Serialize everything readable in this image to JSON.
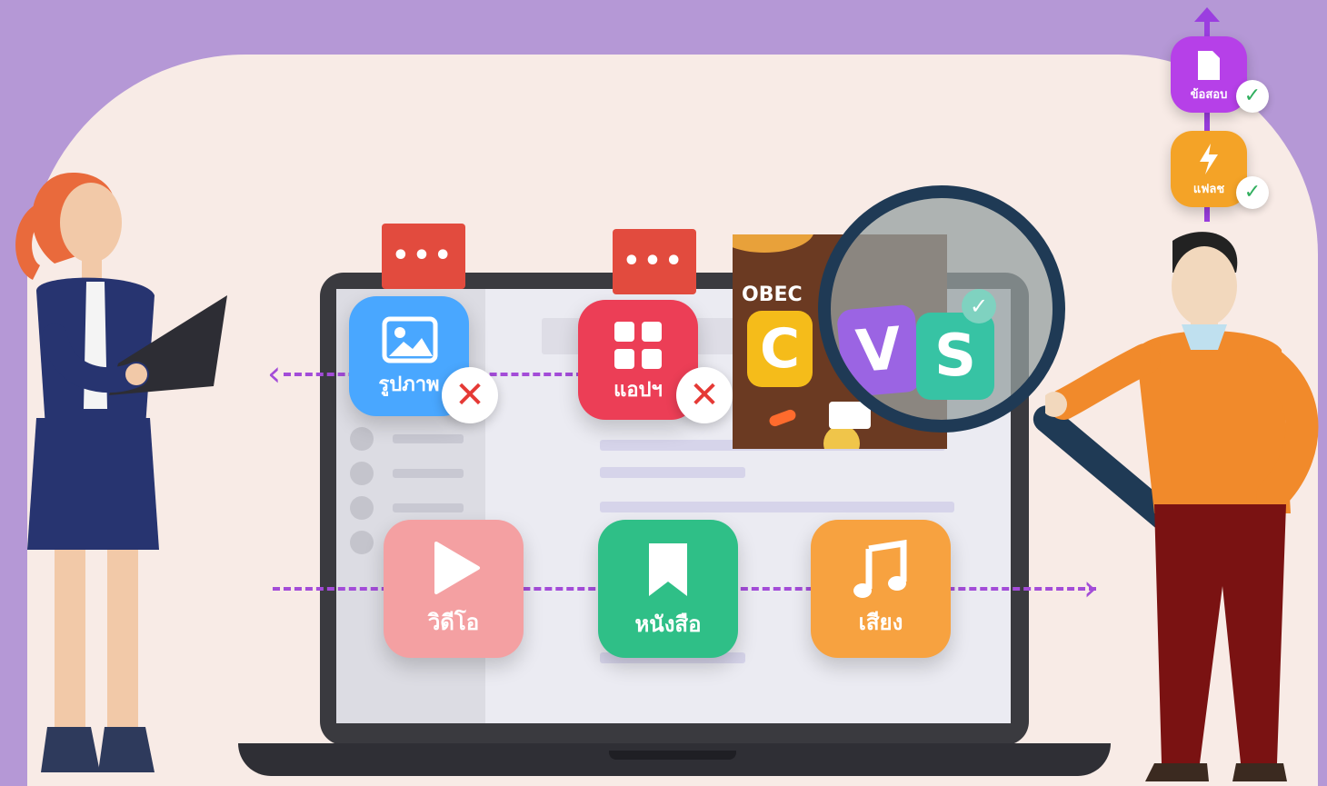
{
  "colors": {
    "background": "#b598d6",
    "panel": "#f8ebe6",
    "accent_dash": "#a34cd8"
  },
  "apps_top": [
    {
      "label": "รูปภาพ",
      "icon": "image-icon",
      "color": "#49a7ff",
      "status": "rejected"
    },
    {
      "label": "แอปฯ",
      "icon": "grid-icon",
      "color": "#ec3e56",
      "status": "rejected"
    }
  ],
  "apps_bottom": [
    {
      "label": "วิดีโอ",
      "icon": "play-icon",
      "color": "#f4a0a2"
    },
    {
      "label": "หนังสือ",
      "icon": "bookmark-icon",
      "color": "#2fbf87"
    },
    {
      "label": "เสียง",
      "icon": "music-icon",
      "color": "#f7a240"
    }
  ],
  "bubble_text": "•••",
  "game_card": {
    "brand": "OBEC",
    "letters": [
      "C",
      "V",
      "S"
    ]
  },
  "stack": [
    {
      "label": "ข้อสอบ",
      "icon": "document-icon",
      "color": "#b640e8",
      "status": "approved"
    },
    {
      "label": "แฟลช",
      "icon": "lightning-icon",
      "color": "#f4a327",
      "status": "approved"
    }
  ]
}
